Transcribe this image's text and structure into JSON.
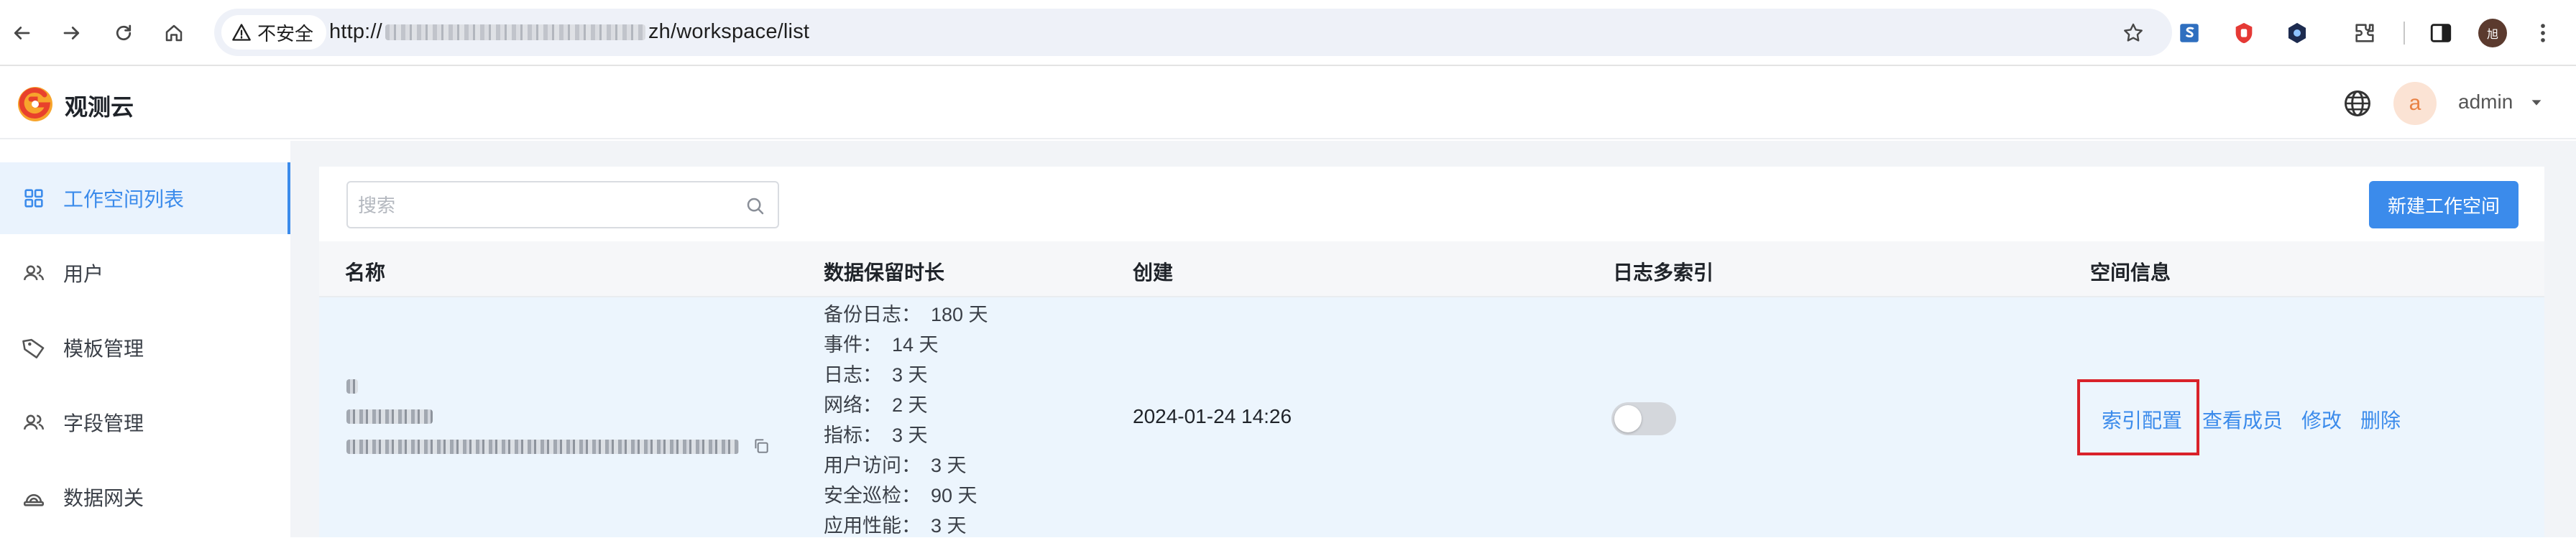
{
  "browser": {
    "security_label": "不安全",
    "url_prefix": "http://",
    "url_suffix": "zh/workspace/list",
    "profile_initial": "旭"
  },
  "app": {
    "name": "观测云",
    "user_avatar_letter": "a",
    "user_name": "admin"
  },
  "sidebar": {
    "items": [
      {
        "label": "工作空间列表",
        "icon": "grid-icon",
        "active": true
      },
      {
        "label": "用户",
        "icon": "users-icon",
        "active": false
      },
      {
        "label": "模板管理",
        "icon": "tag-icon",
        "active": false
      },
      {
        "label": "字段管理",
        "icon": "users-icon",
        "active": false
      },
      {
        "label": "数据网关",
        "icon": "gateway-icon",
        "active": false
      }
    ]
  },
  "toolbar": {
    "search_placeholder": "搜索",
    "new_button": "新建工作空间"
  },
  "table": {
    "columns": [
      "名称",
      "数据保留时长",
      "创建",
      "日志多索引",
      "空间信息"
    ],
    "rows": [
      {
        "retention": [
          {
            "k": "备份日志：",
            "v": "180 天"
          },
          {
            "k": "事件：",
            "v": "14 天"
          },
          {
            "k": "日志：",
            "v": "3 天"
          },
          {
            "k": "网络：",
            "v": "2 天"
          },
          {
            "k": "指标：",
            "v": "3 天"
          },
          {
            "k": "用户访问：",
            "v": "3 天"
          },
          {
            "k": "安全巡检：",
            "v": "90 天"
          },
          {
            "k": "应用性能：",
            "v": "3 天"
          }
        ],
        "created": "2024-01-24 14:26",
        "multi_index_enabled": false,
        "actions": [
          "索引配置",
          "查看成员",
          "修改",
          "删除"
        ]
      }
    ]
  },
  "colors": {
    "accent": "#3b8beb",
    "highlight": "#d9222a",
    "row_bg": "#ecf5fd"
  }
}
